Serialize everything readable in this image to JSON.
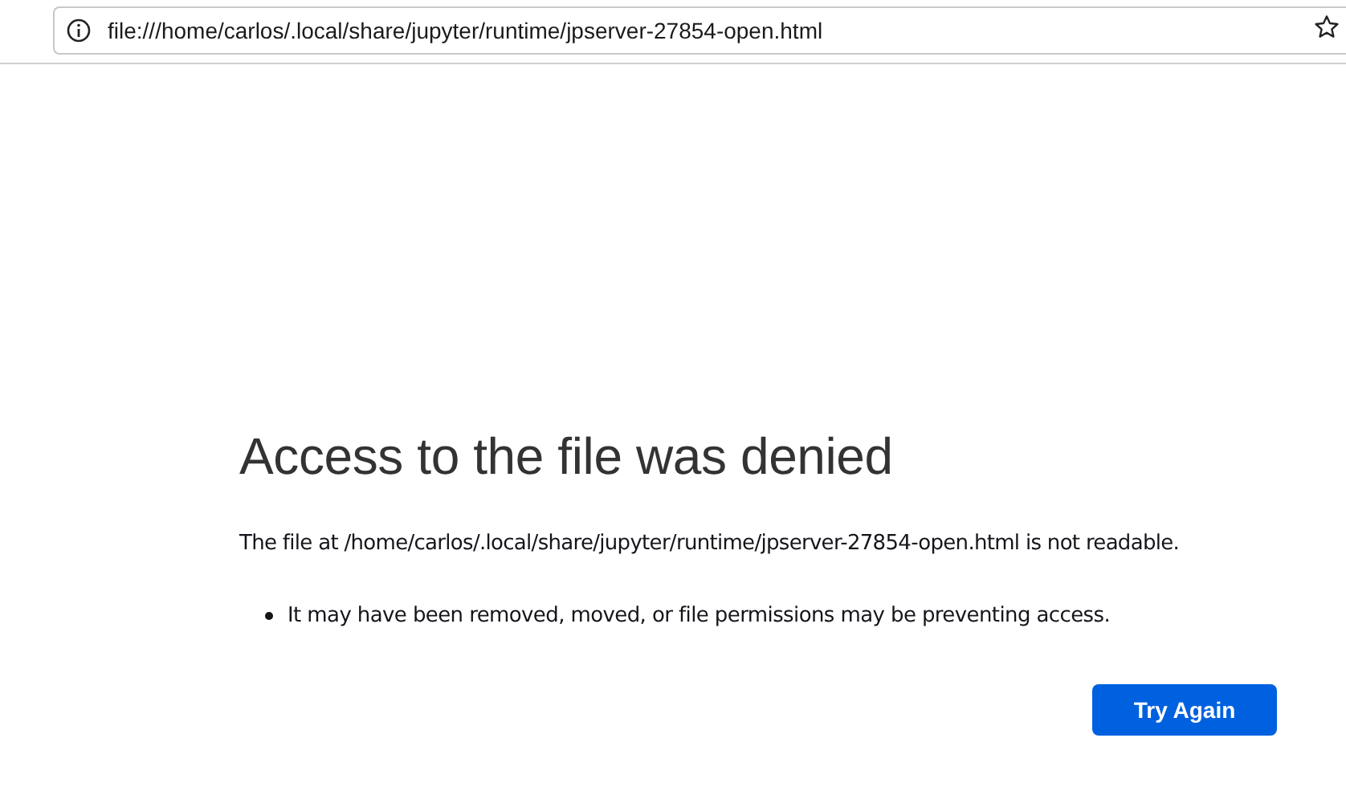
{
  "address_bar": {
    "url": "file:///home/carlos/.local/share/jupyter/runtime/jpserver-27854-open.html"
  },
  "error": {
    "title": "Access to the file was denied",
    "message": "The file at /home/carlos/.local/share/jupyter/runtime/jpserver-27854-open.html is not readable.",
    "reasons": [
      "It may have been removed, moved, or file permissions may be preventing access."
    ],
    "button": "Try Again"
  }
}
